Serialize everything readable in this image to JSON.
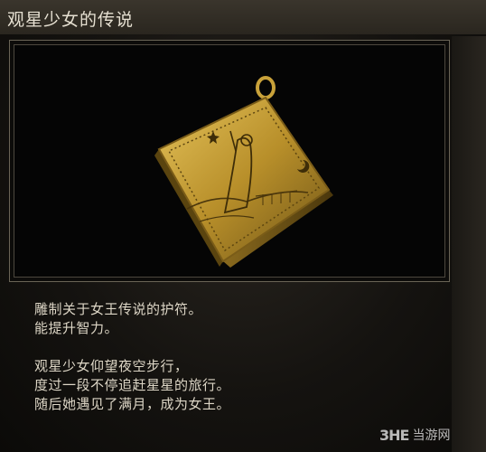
{
  "item": {
    "name": "观星少女的传说",
    "description_lines": [
      "雕制关于女王传说的护符。",
      "能提升智力。"
    ],
    "lore_lines": [
      "观星少女仰望夜空步行，",
      "度过一段不停追赶星星的旅行。",
      "随后她遇见了满月，成为女王。"
    ],
    "image_icon": "talisman-amulet-icon"
  },
  "watermark": {
    "logo": "3HE",
    "site": "当游网"
  },
  "colors": {
    "gold": "#c9a23a",
    "gold_dark": "#6e5417",
    "frame": "#6a6456"
  }
}
